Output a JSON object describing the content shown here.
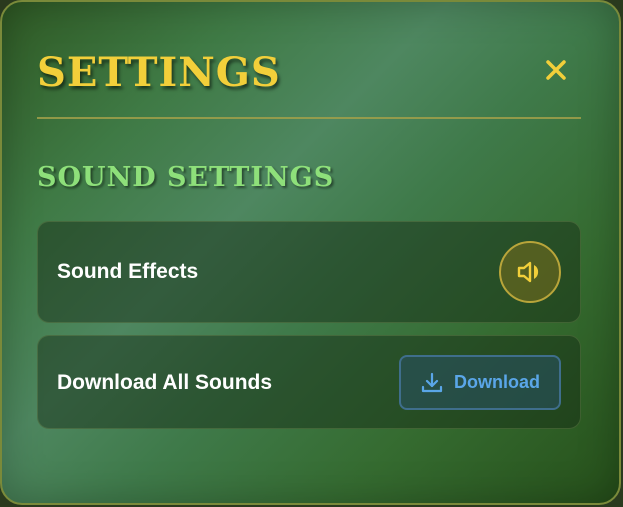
{
  "modal": {
    "title": "SETTINGS",
    "close_icon": "close-icon"
  },
  "sound_section": {
    "title": "SOUND SETTINGS",
    "sound_effects": {
      "label": "Sound Effects",
      "icon": "speaker-icon"
    },
    "download_all": {
      "label": "Download All Sounds",
      "button_label": "Download",
      "icon": "download-icon"
    }
  },
  "colors": {
    "title": "#f2cf3a",
    "section_title": "#8ee07a",
    "download_accent": "#5aa6e8",
    "toggle_accent": "#f2cf3a"
  }
}
